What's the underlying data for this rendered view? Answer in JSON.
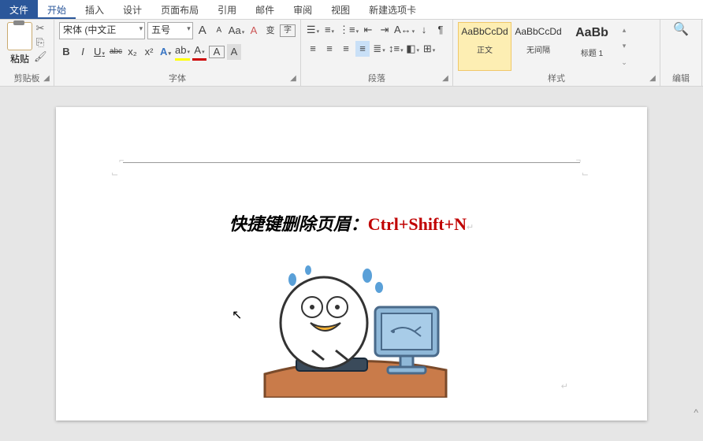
{
  "tabs": {
    "file": "文件",
    "home": "开始",
    "insert": "插入",
    "design": "设计",
    "layout": "页面布局",
    "ref": "引用",
    "mail": "邮件",
    "review": "审阅",
    "view": "视图",
    "newtab": "新建选项卡"
  },
  "ribbon": {
    "clipboard": {
      "label": "剪贴板",
      "paste": "粘贴"
    },
    "font": {
      "label": "字体",
      "name": "宋体 (中文正",
      "size": "五号",
      "grow": "A",
      "shrink": "A",
      "case": "Aa",
      "clear": "A",
      "phon": "变",
      "enclose": "字",
      "bold": "B",
      "italic": "I",
      "underline": "U",
      "strike": "abc",
      "sub": "x₂",
      "sup": "x²",
      "effect": "A",
      "highlight": "ab",
      "color": "A",
      "border": "A",
      "shade": "A"
    },
    "para": {
      "label": "段落"
    },
    "styles": {
      "label": "样式",
      "s1": {
        "preview": "AaBbCcDd",
        "name": "正文"
      },
      "s2": {
        "preview": "AaBbCcDd",
        "name": "无间隔"
      },
      "s3": {
        "preview": "AaBb",
        "name": "标题 1"
      }
    },
    "edit": {
      "label": "编辑",
      "find": "🔍"
    }
  },
  "doc": {
    "text1": "快捷键删除页眉：",
    "text2": "Ctrl+Shift+N",
    "pm": "↵"
  }
}
